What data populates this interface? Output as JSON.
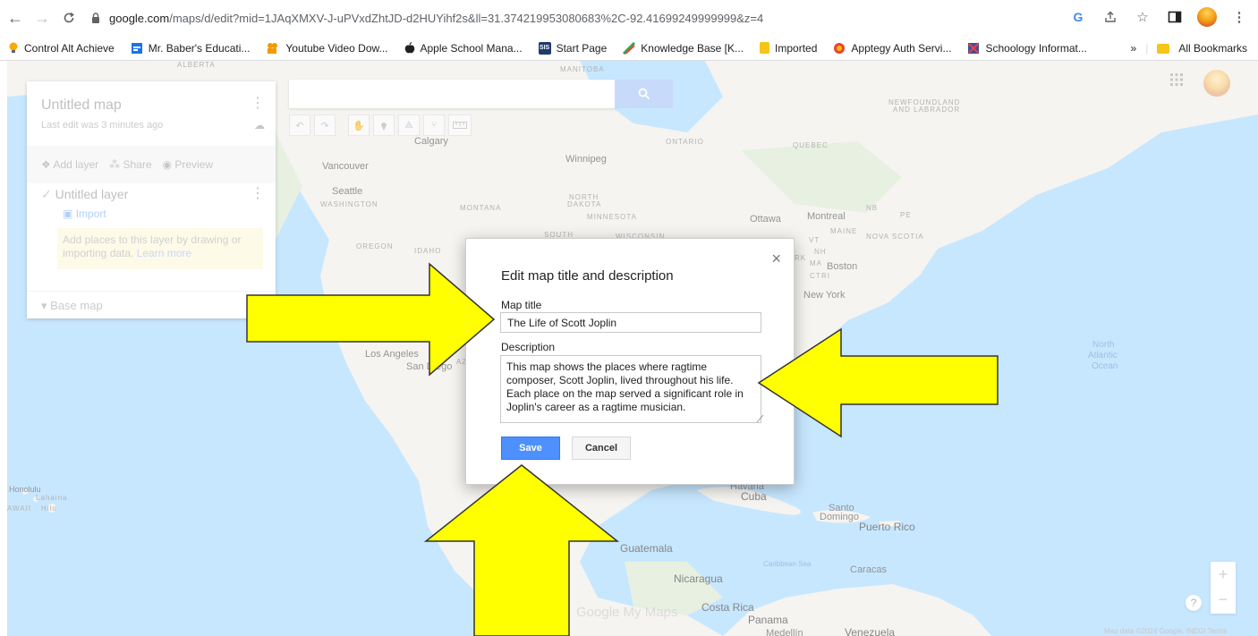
{
  "browser": {
    "url_host": "google.com",
    "url_rest": "/maps/d/edit?mid=1JAqXMXV-J-uPVxdZhtJD-d2HUYihf2s&ll=31.374219953080683%2C-92.41699249999999&z=4",
    "bookmarks": [
      {
        "label": "Control Alt Achieve",
        "color": "#f9ab00"
      },
      {
        "label": "Mr. Baber's Educati...",
        "color": "#1a73e8"
      },
      {
        "label": "Youtube Video Dow...",
        "color": "#f29900"
      },
      {
        "label": "Apple School Mana...",
        "color": "#202124"
      },
      {
        "label": "Start Page",
        "color": "#1f3a6e"
      },
      {
        "label": "Knowledge Base [K...",
        "color": "#34a853"
      },
      {
        "label": "Imported",
        "color": "#f5c518"
      },
      {
        "label": "Apptegy Auth Servi...",
        "color": "#ea4335"
      },
      {
        "label": "Schoology Informat...",
        "color": "#3c4da8"
      }
    ],
    "overflow_label": "»",
    "all_bookmarks": "All Bookmarks",
    "sis_badge": "SIS"
  },
  "panel": {
    "title": "Untitled map",
    "subtitle": "Last edit was 3 minutes ago",
    "add_layer": "Add layer",
    "share": "Share",
    "preview": "Preview",
    "layer_name": "Untitled layer",
    "import": "Import",
    "note": "Add places to this layer by drawing or importing data.",
    "learn_more": "Learn more",
    "base_map": "Base map"
  },
  "map": {
    "wordmark": "Google My Maps",
    "attribution": "Map data ©2024 Google, INEGI   Terms",
    "labels": {
      "alberta": "ALBERTA",
      "manitoba": "MANITOBA",
      "calgary": "Calgary",
      "vancouver": "Vancouver",
      "winnipeg": "Winnipeg",
      "ontario": "ONTARIO",
      "quebec": "QUEBEC",
      "newfoundland": "NEWFOUNDLAND",
      "and_labrador": "AND LABRADOR",
      "seattle": "Seattle",
      "washington": "WASHINGTON",
      "montana": "MONTANA",
      "north": "NORTH",
      "dakota": "DAKOTA",
      "minnesota": "MINNESOTA",
      "ottawa": "Ottawa",
      "montreal": "Montreal",
      "nb": "NB",
      "pe": "PE",
      "south": "SOUTH",
      "wisconsin": "WISCONSIN",
      "oregon": "OREGON",
      "idaho": "IDAHO",
      "vt": "VT",
      "maine": "MAINE",
      "nova_scotia": "NOVA SCOTIA",
      "nh": "NH",
      "boston": "Boston",
      "ma": "MA",
      "ct": "CT",
      "ri": "RI",
      "rk": "RK",
      "new_york": "New York",
      "los_angeles": "Los Angeles",
      "san_diego": "San Diego",
      "az": "AZ",
      "north_atlantic_1": "North",
      "north_atlantic_2": "Atlantic",
      "north_atlantic_3": "Ocean",
      "honolulu": "Honolulu",
      "lahaina": "Lahaina",
      "hawaii": "AWAII",
      "hilo": "Hilo",
      "havana": "Havana",
      "cuba": "Cuba",
      "santo": "Santo",
      "domingo": "Domingo",
      "puerto_rico": "Puerto Rico",
      "guatemala": "Guatemala",
      "caribbean": "Caribbean Sea",
      "nicaragua": "Nicaragua",
      "caracas": "Caracas",
      "costa_rica": "Costa Rica",
      "panama": "Panama",
      "medellin": "Medellín",
      "venezuela": "Venezuela"
    }
  },
  "dialog": {
    "title": "Edit map title and description",
    "map_title_label": "Map title",
    "map_title_value": "The Life of Scott Joplin",
    "description_label": "Description",
    "description_value": "This map shows the places where ragtime composer, Scott Joplin, lived throughout his life. Each place on the map served a significant role in Joplin's career as a ragtime musician.",
    "save": "Save",
    "cancel": "Cancel",
    "close": "×"
  },
  "colors": {
    "arrow_fill": "#ffff00",
    "save_button": "#4d90fe"
  }
}
